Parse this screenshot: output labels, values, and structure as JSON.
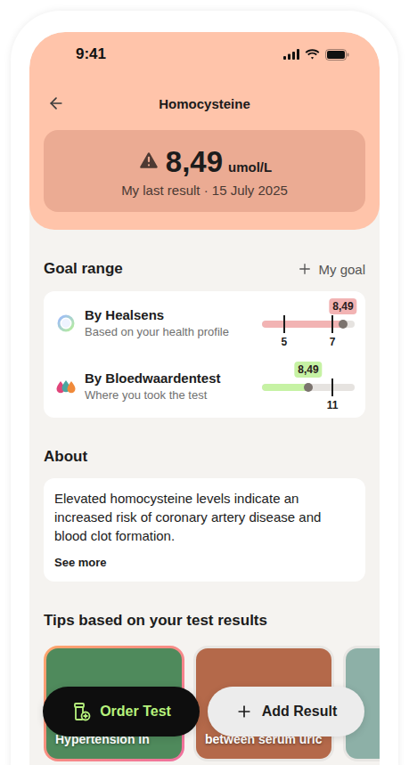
{
  "status_bar": {
    "time": "9:41"
  },
  "header": {
    "title": "Homocysteine"
  },
  "result": {
    "value": "8,49",
    "unit": "umol/L",
    "subtitle": "My last result · 15 July 2025",
    "warning": true
  },
  "goal_range": {
    "title": "Goal range",
    "action": "My goal",
    "ranges": [
      {
        "name": "By Healsens",
        "subtitle": "Based on your health profile",
        "badge": "8,49",
        "level": 0.875,
        "color": "#f2b3b3",
        "source": "healsens",
        "ticks": [
          {
            "label": "5",
            "level": 0.24
          },
          {
            "label": "7",
            "level": 0.76
          }
        ]
      },
      {
        "name": "By Bloedwaardentest",
        "subtitle": "Where you took the test",
        "badge": "8,49",
        "level": 0.5,
        "color": "#c6f2a4",
        "source": "lab",
        "ticks": [
          {
            "label": "11",
            "level": 0.76
          }
        ]
      }
    ]
  },
  "about": {
    "title": "About",
    "text": "Elevated homocysteine levels indicate an increased risk of coronary artery disease and blood clot formation.",
    "link": "See more"
  },
  "tips": {
    "title": "Tips based on your test results",
    "cards": [
      {
        "caption": "Hypertension in",
        "selected": true
      },
      {
        "caption": "between serum uric",
        "selected": false
      },
      {
        "caption": "",
        "selected": false
      }
    ]
  },
  "actions": [
    {
      "label": "Order Test",
      "kind": "primary"
    },
    {
      "label": "Add Result",
      "kind": "secondary"
    }
  ]
}
